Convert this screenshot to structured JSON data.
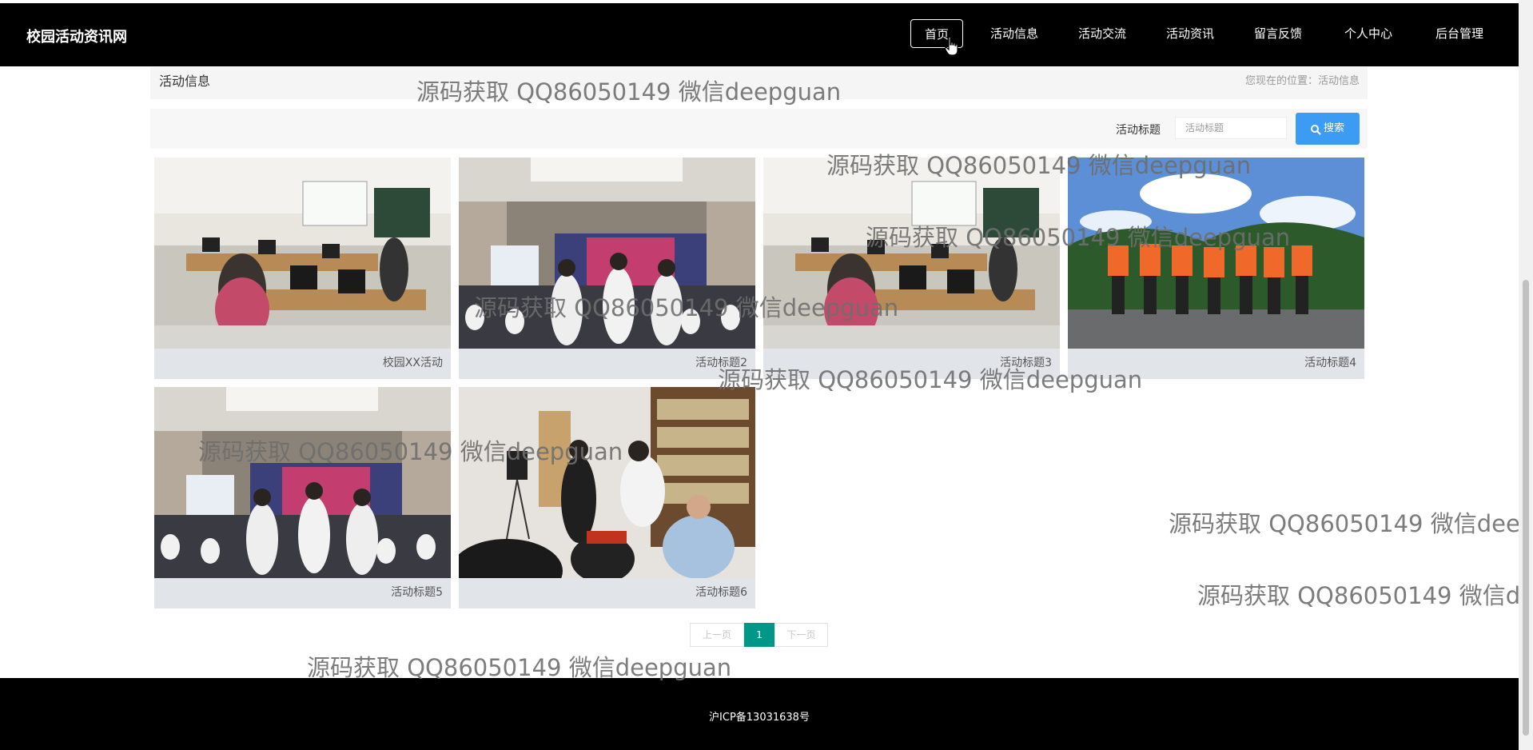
{
  "header": {
    "brand": "校园活动资讯网",
    "nav": [
      {
        "label": "首页",
        "active": true
      },
      {
        "label": "活动信息",
        "active": false
      },
      {
        "label": "活动交流",
        "active": false
      },
      {
        "label": "活动资讯",
        "active": false
      },
      {
        "label": "留言反馈",
        "active": false
      },
      {
        "label": "个人中心",
        "active": false
      },
      {
        "label": "后台管理",
        "active": false
      }
    ]
  },
  "breadcrumb": {
    "title": "活动信息",
    "location": "您现在的位置：活动信息"
  },
  "search": {
    "label": "活动标题",
    "placeholder": "活动标题",
    "button_label": "搜索"
  },
  "cards": [
    {
      "title": "校园XX活动",
      "image": "classroom-computers-photo"
    },
    {
      "title": "活动标题2",
      "image": "auditorium-students-photo"
    },
    {
      "title": "活动标题3",
      "image": "classroom-computers-photo"
    },
    {
      "title": "活动标题4",
      "image": "group-life-jackets-photo"
    },
    {
      "title": "活动标题5",
      "image": "auditorium-students-photo"
    },
    {
      "title": "活动标题6",
      "image": "library-demo-photo"
    }
  ],
  "pagination": {
    "prev": "上一页",
    "current": "1",
    "next": "下一页"
  },
  "watermark": {
    "text": "源码获取 QQ86050149 微信deepguan"
  },
  "footer": {
    "icp": "沪ICP备13031638号"
  },
  "colors": {
    "navbar": "#000000",
    "search_button": "#3c9cf4",
    "pager_active": "#009688"
  }
}
